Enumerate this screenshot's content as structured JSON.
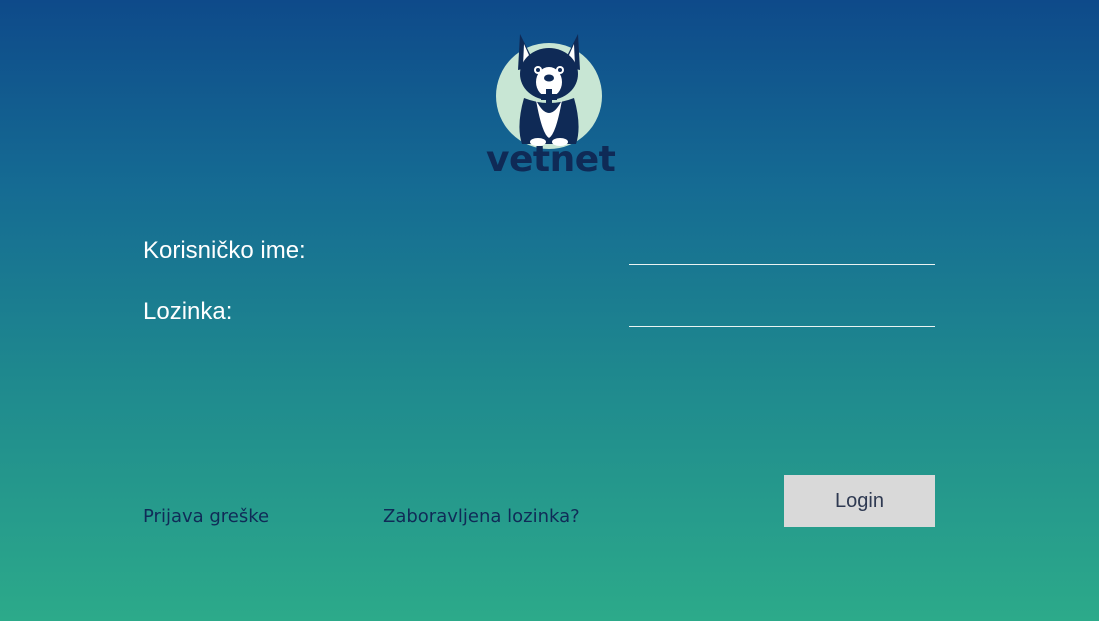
{
  "logo": {
    "brand_text": "vetnet",
    "icon": "dog-with-medical-cross-logo",
    "colors": {
      "navy": "#0f2a56",
      "circle": "#c8e6d4"
    }
  },
  "form": {
    "username_label": "Korisničko ime:",
    "username_value": "",
    "password_label": "Lozinka:",
    "password_value": ""
  },
  "actions": {
    "login_label": "Login",
    "report_bug_label": "Prijava greške",
    "forgot_password_label": "Zaboravljena lozinka?"
  },
  "colors": {
    "background_top": "#0e4a8a",
    "background_bottom": "#2caa8a",
    "link": "#102b57",
    "button": "#d9d9d9"
  }
}
